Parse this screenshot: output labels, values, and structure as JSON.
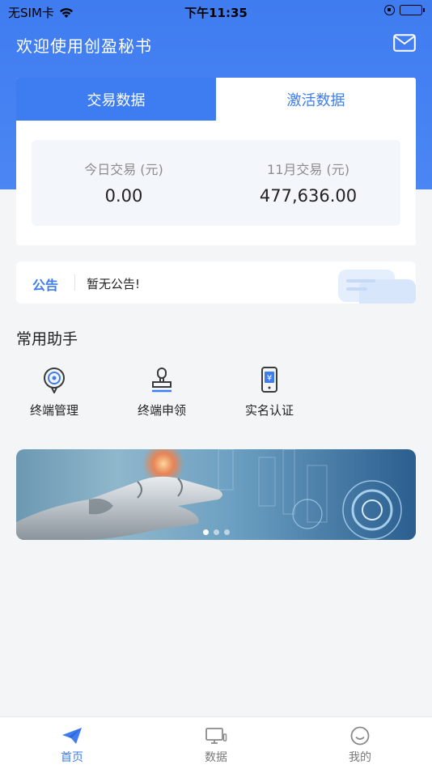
{
  "status_bar": {
    "carrier": "无SIM卡",
    "time": "下午11:35"
  },
  "header": {
    "title": "欢迎使用创盈秘书"
  },
  "data_card": {
    "tabs": [
      "交易数据",
      "激活数据"
    ],
    "active_tab": 0,
    "stats": [
      {
        "label": "今日交易 (元)",
        "value": "0.00"
      },
      {
        "label": "11月交易 (元)",
        "value": "477,636.00"
      }
    ]
  },
  "notice": {
    "tag": "公告",
    "text": "暂无公告!"
  },
  "helpers": {
    "title": "常用助手",
    "items": [
      {
        "label": "终端管理",
        "icon": "terminal-management-icon"
      },
      {
        "label": "终端申领",
        "icon": "terminal-apply-icon"
      },
      {
        "label": "实名认证",
        "icon": "real-name-auth-icon"
      }
    ]
  },
  "banner": {
    "slide_count": 3,
    "active_slide": 0
  },
  "tabbar": {
    "items": [
      {
        "label": "首页",
        "icon": "paper-plane-icon",
        "active": true
      },
      {
        "label": "数据",
        "icon": "monitor-icon",
        "active": false
      },
      {
        "label": "我的",
        "icon": "smile-icon",
        "active": false
      }
    ]
  },
  "colors": {
    "primary": "#3e7cf1",
    "header_bg": "#4583f2",
    "page_bg": "#f4f5f7"
  }
}
